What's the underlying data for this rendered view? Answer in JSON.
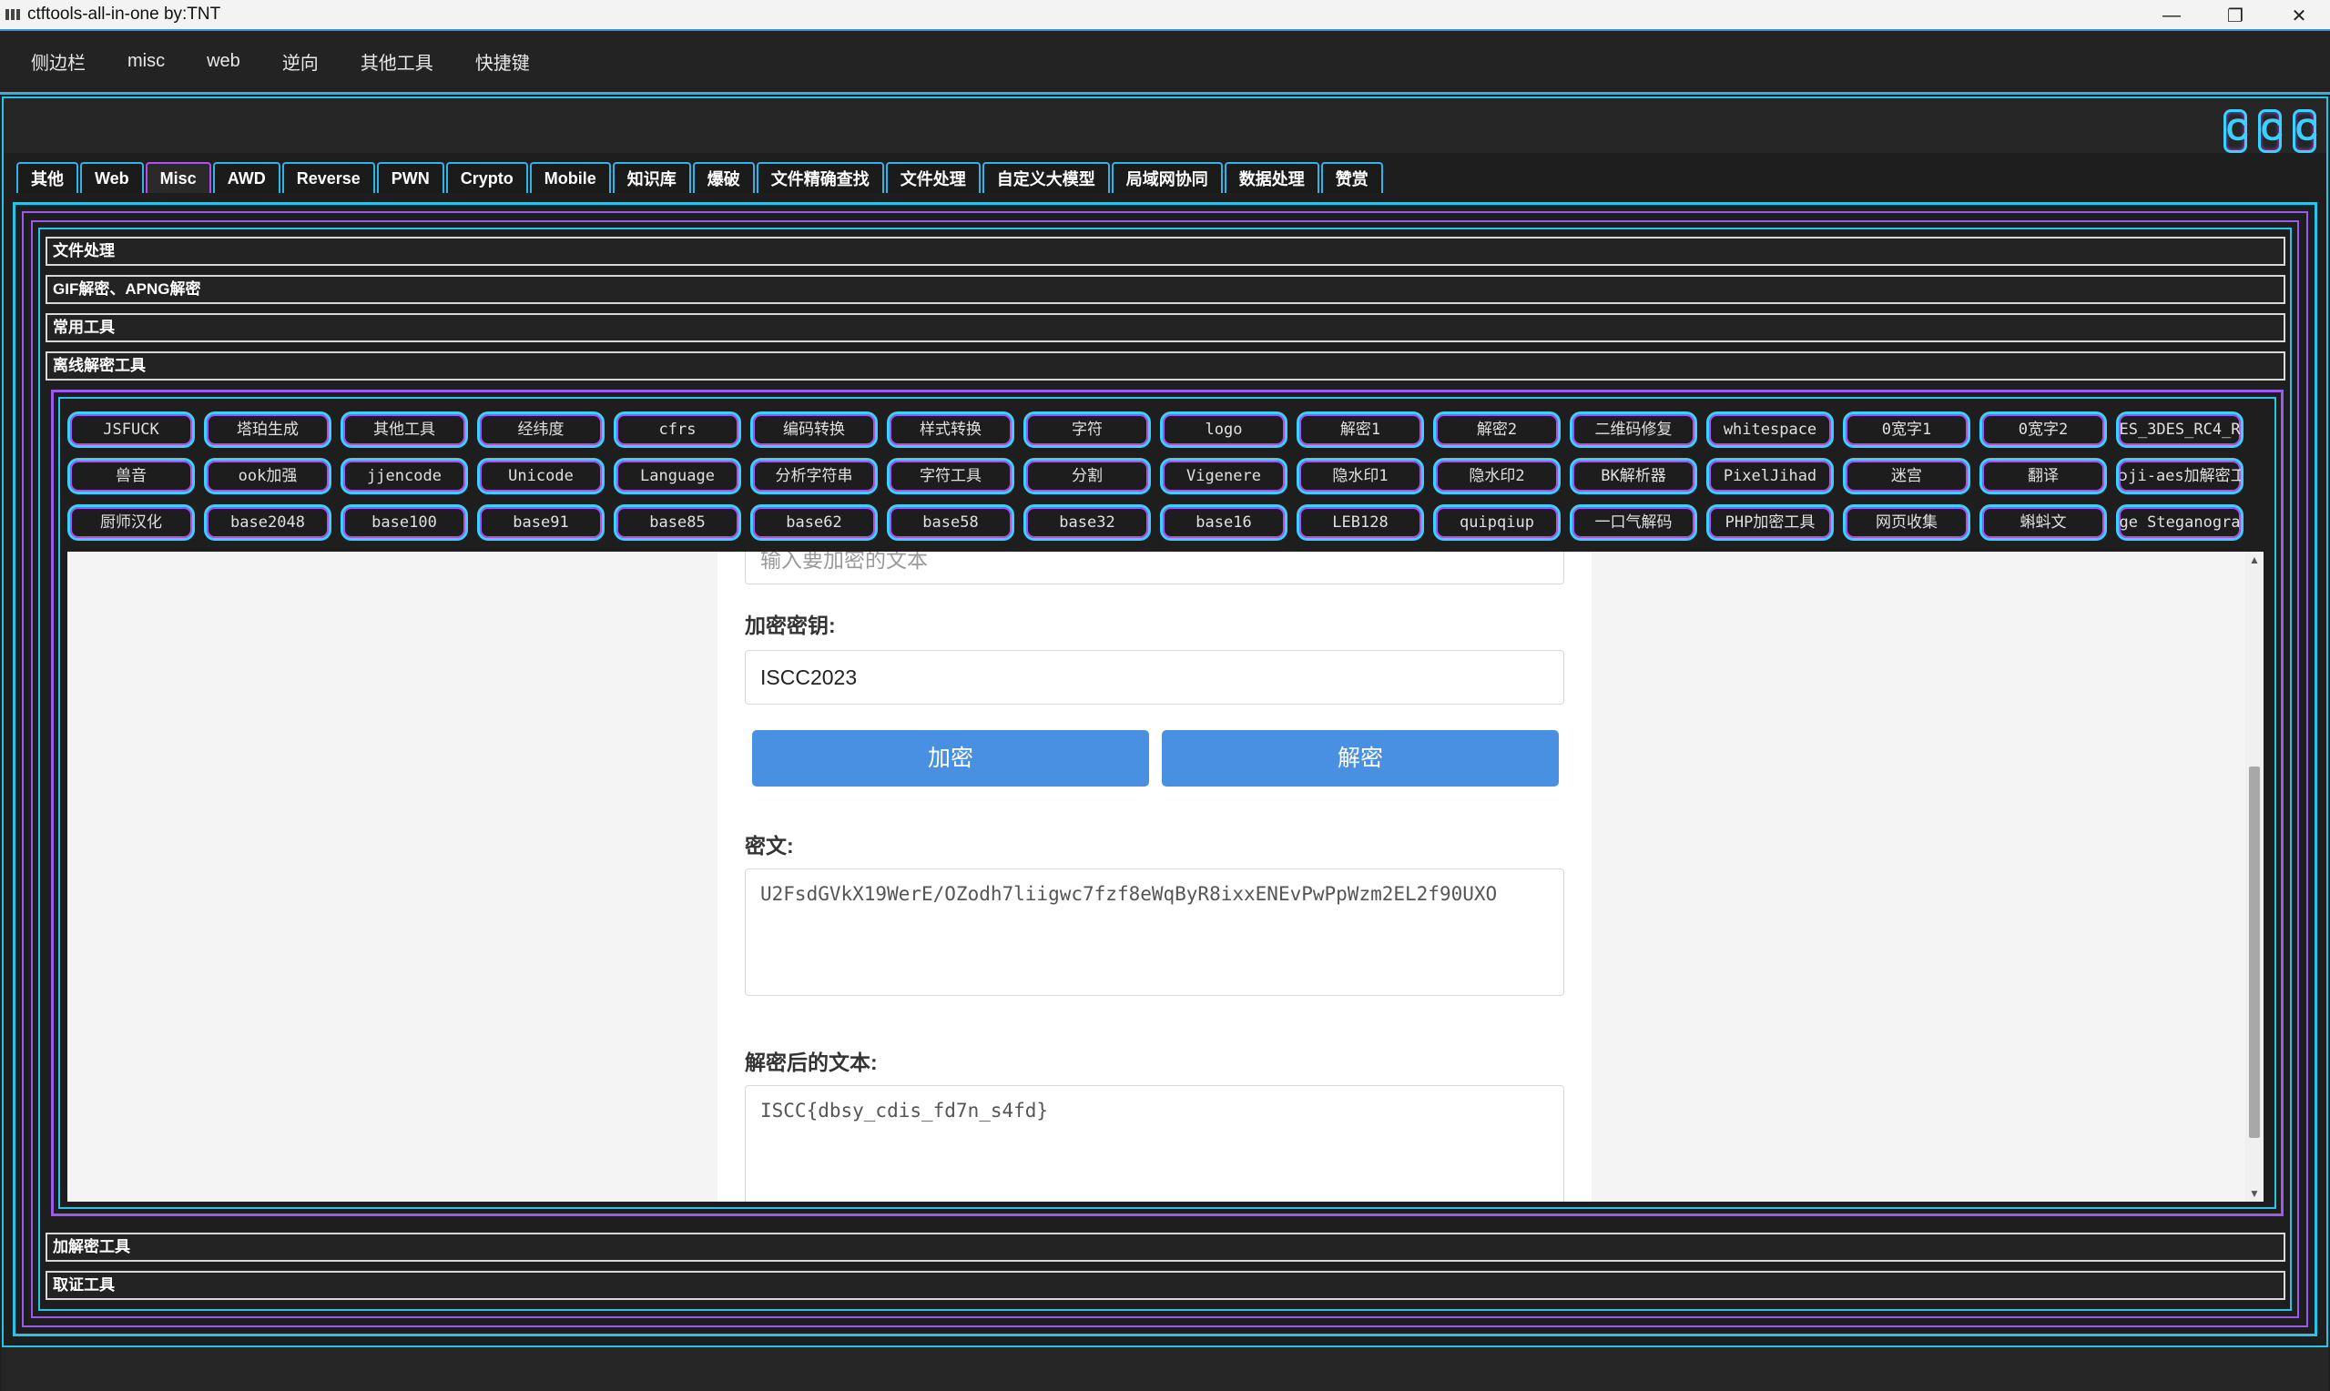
{
  "window": {
    "title": "ctftools-all-in-one   by:TNT",
    "minimize": "—",
    "maximize": "❐",
    "close": "✕"
  },
  "menu": [
    "侧边栏",
    "misc",
    "web",
    "逆向",
    "其他工具",
    "快捷键"
  ],
  "corner_buttons": [
    "C",
    "C",
    "C"
  ],
  "tabs": [
    "其他",
    "Web",
    "Misc",
    "AWD",
    "Reverse",
    "PWN",
    "Crypto",
    "Mobile",
    "知识库",
    "爆破",
    "文件精确查找",
    "文件处理",
    "自定义大模型",
    "局域网协同",
    "数据处理",
    "赞赏"
  ],
  "active_tab": "Misc",
  "sections_top": [
    "文件处理",
    "GIF解密、APNG解密",
    "常用工具",
    "离线解密工具"
  ],
  "sections_bottom": [
    "加解密工具",
    "取证工具"
  ],
  "tool_rows": [
    [
      "JSFUCK",
      "塔珀生成",
      "其他工具",
      "经纬度",
      "cfrs",
      "编码转换",
      "样式转换",
      "字符",
      "logo",
      "解密1",
      "解密2",
      "二维码修复",
      "whitespace",
      "0宽字1",
      "0宽字2",
      "ES_3DES_RC4_R"
    ],
    [
      "兽音",
      "ook加强",
      "jjencode",
      "Unicode",
      "Language",
      "分析字符串",
      "字符工具",
      "分割",
      "Vigenere",
      "隐水印1",
      "隐水印2",
      "BK解析器",
      "PixelJihad",
      "迷宫",
      "翻译",
      "ɔji-aes加解密工"
    ],
    [
      "厨师汉化",
      "base2048",
      "base100",
      "base91",
      "base85",
      "base62",
      "base58",
      "base32",
      "base16",
      "LEB128",
      "quipqiup",
      "一口气解码",
      "PHP加密工具",
      "网页收集",
      "蝌蚪文",
      "ge Steganogra"
    ]
  ],
  "web": {
    "top_input_placeholder": "输入要加密的文本",
    "key_label": "加密密钥:",
    "key_value": "ISCC2023",
    "encrypt_btn": "加密",
    "decrypt_btn": "解密",
    "cipher_label": "密文:",
    "cipher_value": "U2FsdGVkX19WerE/OZodh7liigwc7fzf8eWqByR8ixxENEvPwPpWzm2EL2f90UXO",
    "plain_label": "解密后的文本:",
    "plain_value": "ISCC{dbsy_cdis_fd7n_s4fd}",
    "scroll_up": "▲",
    "scroll_down": "▼"
  }
}
